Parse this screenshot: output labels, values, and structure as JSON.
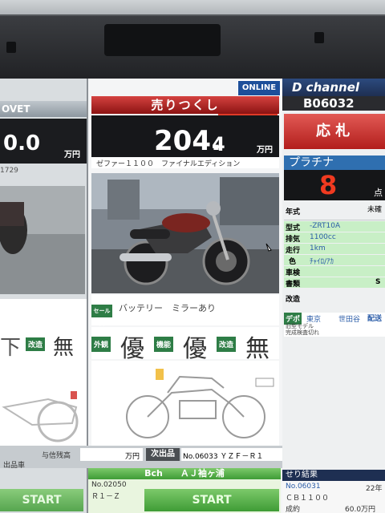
{
  "left_panel": {
    "header": "OVET",
    "price": "0.0",
    "price_unit": "万円",
    "lot_fragment": "1729",
    "grade_exterior": "下",
    "grade_modify_label": "改造",
    "grade_modify": "無"
  },
  "center_panel": {
    "title": "売りつくし",
    "price_main": "204.",
    "price_decimal": "4",
    "price_unit": "万円",
    "model_name": "ゼファー１１００　ファイナルエディション",
    "sales_label": "セールス",
    "sales_note": "バッテリー　ミラーあり",
    "grades": [
      {
        "label": "外観",
        "value": "優"
      },
      {
        "label": "機能",
        "value": "優"
      },
      {
        "label": "改造",
        "value": "無"
      }
    ]
  },
  "right_panel": {
    "online_badge": "ONLINE",
    "channel": "D channel",
    "lot_number": "B06032",
    "bid_button": "応 札",
    "grade_label": "プラチナ",
    "points": "8",
    "points_unit": "点",
    "spec_rows": [
      {
        "label": "年式",
        "value": "",
        "extra": "未確"
      },
      {
        "label": "型式",
        "value": "-ZRT10A",
        "extra": ""
      },
      {
        "label": "排気",
        "value": "1100cc",
        "extra": ""
      },
      {
        "label": "走行",
        "value": "1km",
        "extra": ""
      },
      {
        "label": "色",
        "value": "ﾁｬｲﾛ/ｱｶ",
        "extra": ""
      },
      {
        "label": "車検",
        "value": "",
        "extra": ""
      },
      {
        "label": "書類",
        "value": "",
        "extra": "S"
      },
      {
        "label": "改造",
        "value": "",
        "extra": ""
      }
    ],
    "depot_label": "デポ",
    "depot_value": "東京",
    "depot_area": "世田谷",
    "delivery_label": "配送",
    "remark_line1": "旧型モデル",
    "remark_line2": "完成検査切れ"
  },
  "bottom": {
    "left_strip_label": "与信残高",
    "left_strip_unit": "万円",
    "next_button": "次出品",
    "next_lot": "No.06033 ＹＺＦ－Ｒ１",
    "bottom_left_label": "出品車",
    "bch_header": "Bch　　ＡＪ袖ヶ浦",
    "bch_lot": "No.02050",
    "bch_model": "Ｒ１－Ｚ",
    "start_button": "START",
    "start_button_left": "START",
    "result_header": "せり結果",
    "result_lot": "No.06031",
    "result_year": "22年",
    "result_model": "ＣＢ１１００",
    "result_status": "成約",
    "result_price": "60.0万円"
  },
  "colors": {
    "accent_red": "#b21e1c",
    "grade_green": "#2e7d46",
    "price_bg": "#16171a",
    "online_blue": "#1d4f9a",
    "channel_navy": "#1e2f52"
  }
}
